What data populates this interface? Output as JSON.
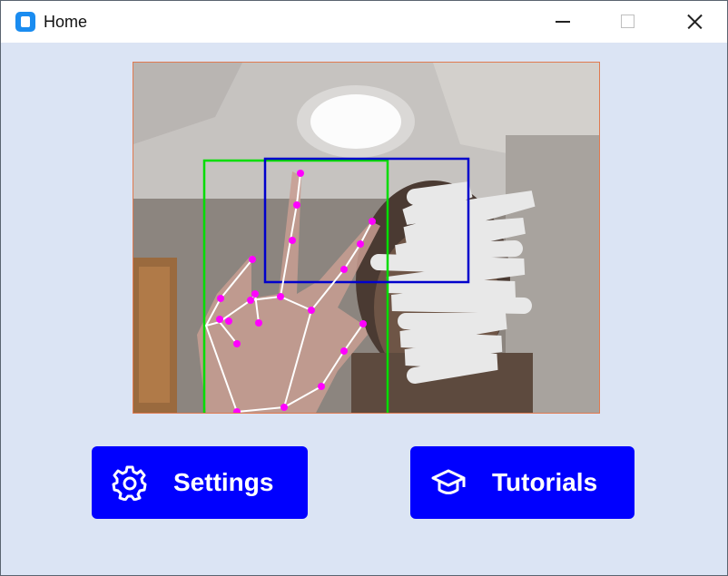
{
  "window": {
    "title": "Home",
    "controls": [
      "minimize-icon",
      "maximize-icon",
      "close-icon"
    ]
  },
  "camera_feed": {
    "description_icon": "camera-feed",
    "overlay_colors": {
      "landmark": "#ff00ff",
      "connection": "#ffffff",
      "hand_box": "#00dd00",
      "gesture_box": "#0000cc"
    }
  },
  "buttons": {
    "settings_label": "Settings",
    "settings_icon": "gear-icon",
    "tutorials_label": "Tutorials",
    "tutorials_icon": "graduation-cap-icon"
  },
  "colors": {
    "background": "#dbe4f4",
    "button": "#0000ff",
    "button_text": "#ffffff"
  }
}
